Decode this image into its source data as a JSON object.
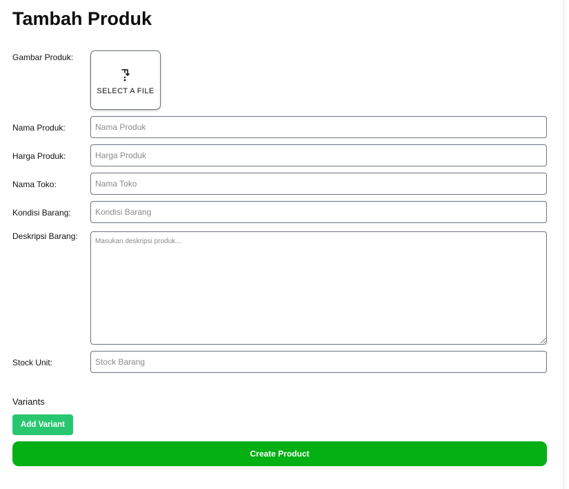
{
  "page": {
    "title": "Tambah Produk"
  },
  "form": {
    "image": {
      "label": "Gambar Produk:",
      "button_label": "Select a file",
      "icon": "upload-icon"
    },
    "name": {
      "label": "Nama Produk:",
      "placeholder": "Nama Produk",
      "value": ""
    },
    "price": {
      "label": "Harga Produk:",
      "placeholder": "Harga Produk",
      "value": ""
    },
    "store": {
      "label": "Nama Toko:",
      "placeholder": "Nama Toko",
      "value": ""
    },
    "condition": {
      "label": "Kondisi Barang:",
      "placeholder": "Kondisi Barang",
      "value": ""
    },
    "description": {
      "label": "Deskripsi Barang:",
      "placeholder": "Masukan deskripsi produk...",
      "value": ""
    },
    "stock": {
      "label": "Stock Unit:",
      "placeholder": "Stock Barang",
      "value": ""
    }
  },
  "variants": {
    "title": "Variants",
    "add_label": "Add Variant"
  },
  "actions": {
    "create_label": "Create Product"
  },
  "colors": {
    "add_variant": "#28c76f",
    "create": "#04b014",
    "border": "#6b7280"
  }
}
